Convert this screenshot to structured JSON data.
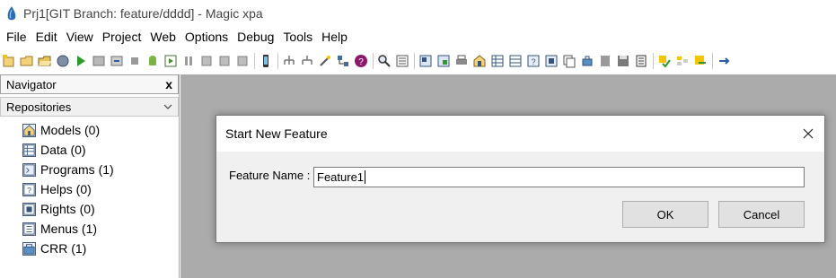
{
  "window": {
    "title": "Prj1[GIT Branch: feature/dddd] - Magic xpa"
  },
  "menu": [
    "File",
    "Edit",
    "View",
    "Project",
    "Web",
    "Options",
    "Debug",
    "Tools",
    "Help"
  ],
  "toolbar": {
    "icons": [
      "new-project-icon",
      "open-project-icon",
      "open-folder-icon",
      "globe-icon",
      "run-icon",
      "export-icon",
      "import-icon",
      "stop-icon",
      "android-icon",
      "preview-icon",
      "pause-icon",
      "step-icon",
      "step-over-icon",
      "step-out-icon",
      "mobile-icon",
      "network-icon",
      "network-2-icon",
      "wand-icon",
      "tree-icon",
      "help-icon",
      "search-icon",
      "list-icon",
      "form-icon",
      "form-2-icon",
      "print-icon",
      "model-icon",
      "data-icon",
      "table-icon",
      "report-icon",
      "menu-icon",
      "copy-icon",
      "move-icon",
      "doc-icon",
      "save-icon",
      "folder-open-icon",
      "check-icon",
      "more-icon"
    ],
    "colors": {
      "run": "#2a9a2a",
      "help": "#8b1a6b",
      "android": "#7cb342"
    }
  },
  "navigator": {
    "title": "Navigator",
    "close_label": "x",
    "combo": "Repositories",
    "items": [
      {
        "label": "Models  (0)",
        "icon": "models-icon"
      },
      {
        "label": "Data  (0)",
        "icon": "data-icon"
      },
      {
        "label": "Programs  (1)",
        "icon": "programs-icon"
      },
      {
        "label": "Helps  (0)",
        "icon": "helps-icon"
      },
      {
        "label": "Rights  (0)",
        "icon": "rights-icon"
      },
      {
        "label": "Menus  (1)",
        "icon": "menus-icon"
      },
      {
        "label": "CRR  (1)",
        "icon": "crr-icon"
      }
    ]
  },
  "dialog": {
    "title": "Start New Feature",
    "field_label": "Feature Name :",
    "field_value": "Feature1",
    "ok_label": "OK",
    "cancel_label": "Cancel"
  }
}
